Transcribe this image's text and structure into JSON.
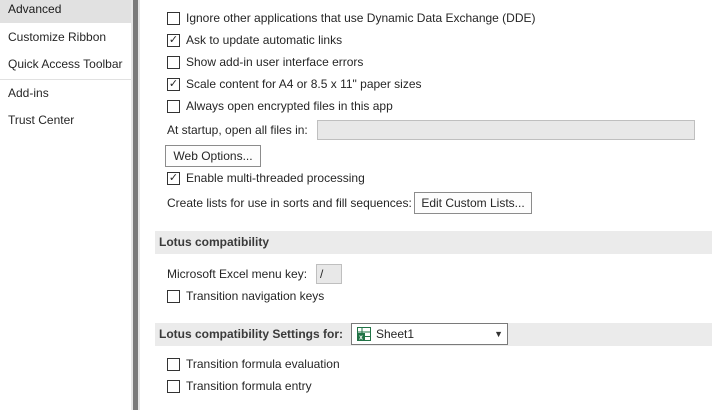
{
  "sidebar": {
    "items": [
      {
        "label": "Advanced",
        "selected": true
      },
      {
        "label": "Customize Ribbon"
      },
      {
        "label": "Quick Access Toolbar"
      },
      {
        "label": "Add-ins"
      },
      {
        "label": "Trust Center"
      }
    ]
  },
  "general": {
    "ignore_dde": {
      "label": "Ignore other applications that use Dynamic Data Exchange (DDE)",
      "checked": false
    },
    "update_links": {
      "label": "Ask to update automatic links",
      "checked": true
    },
    "addin_errors": {
      "label": "Show add-in user interface errors",
      "checked": false
    },
    "scale_content": {
      "label": "Scale content for A4 or 8.5 x 11\" paper sizes",
      "checked": true
    },
    "encrypted_files": {
      "label": "Always open encrypted files in this app",
      "checked": false
    },
    "startup_label": "At startup, open all files in:",
    "startup_value": "",
    "web_options_button": "Web Options...",
    "multithreaded": {
      "label": "Enable multi-threaded processing",
      "checked": true
    },
    "custom_lists_label": "Create lists for use in sorts and fill sequences:",
    "edit_custom_lists_button": "Edit Custom Lists..."
  },
  "lotus": {
    "header": "Lotus compatibility",
    "menu_key_label": "Microsoft Excel menu key:",
    "menu_key_value": "/",
    "transition_nav_keys": {
      "label": "Transition navigation keys",
      "checked": false
    }
  },
  "lotus_settings": {
    "header": "Lotus compatibility Settings for:",
    "sheet_selected": "Sheet1",
    "transition_formula_evaluation": {
      "label": "Transition formula evaluation",
      "checked": false
    },
    "transition_formula_entry": {
      "label": "Transition formula entry",
      "checked": false
    }
  },
  "colors": {
    "selected_nav": "#e1e1e1",
    "section_header": "#ebebeb",
    "excel_green": "#217346"
  }
}
